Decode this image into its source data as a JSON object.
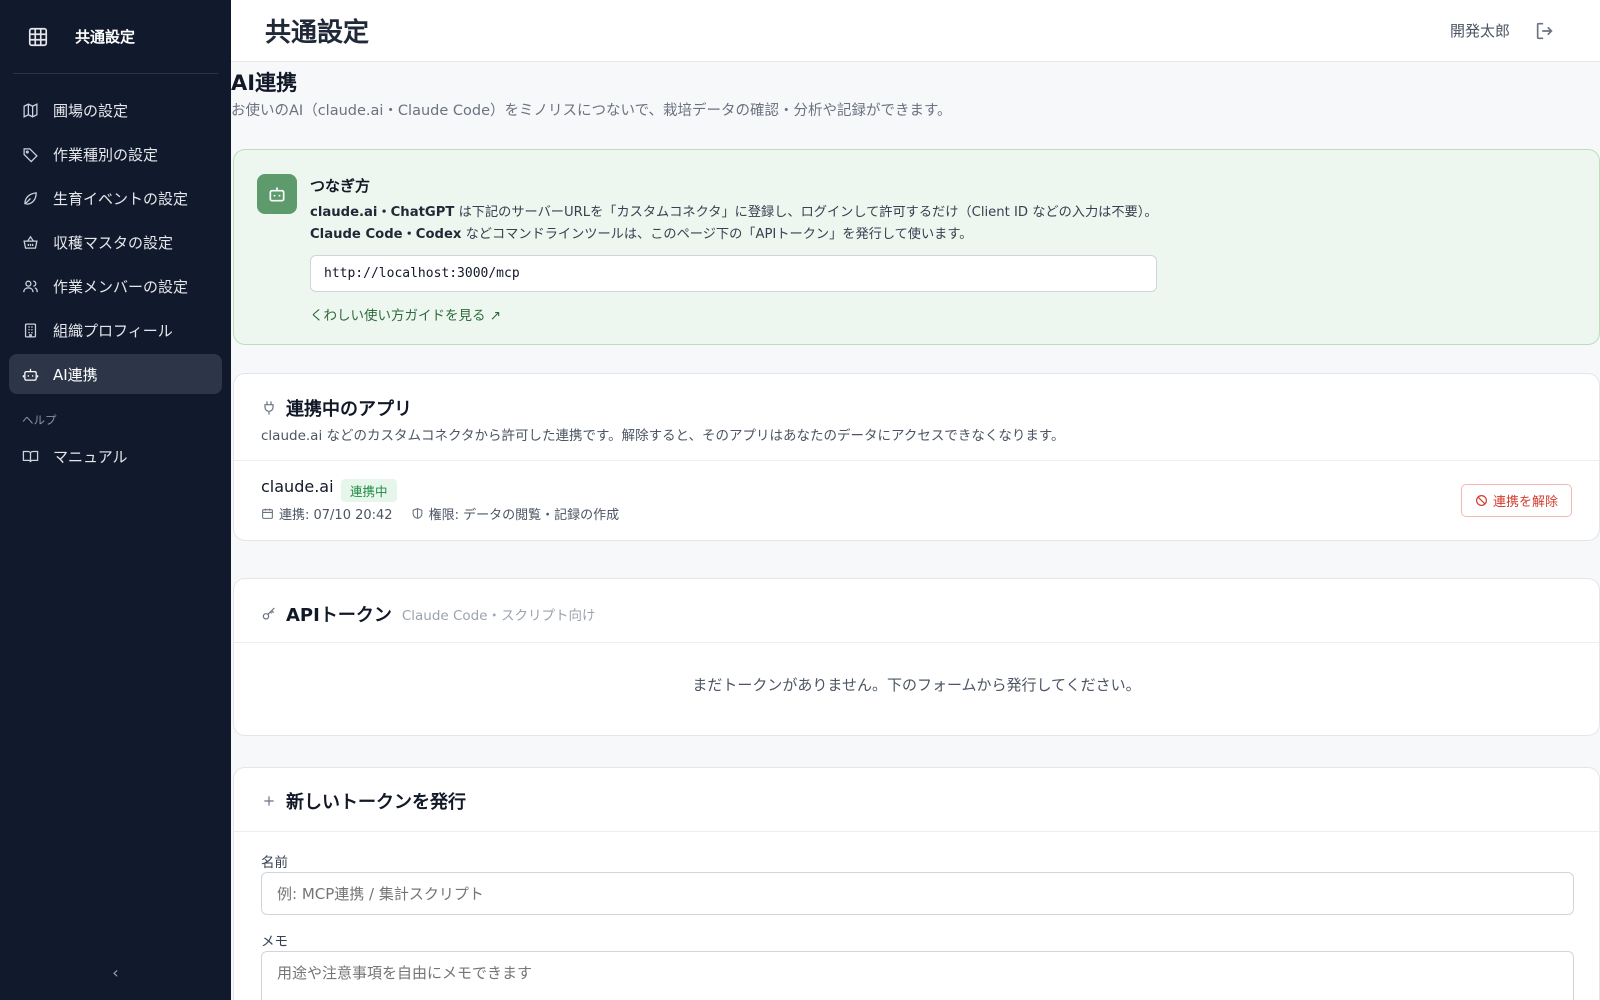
{
  "sidebar": {
    "title": "共通設定",
    "items": [
      {
        "label": "圃場の設定",
        "icon": "map-icon"
      },
      {
        "label": "作業種別の設定",
        "icon": "tag-icon"
      },
      {
        "label": "生育イベントの設定",
        "icon": "leaf-icon"
      },
      {
        "label": "収穫マスタの設定",
        "icon": "basket-icon"
      },
      {
        "label": "作業メンバーの設定",
        "icon": "users-icon"
      },
      {
        "label": "組織プロフィール",
        "icon": "building-icon"
      },
      {
        "label": "AI連携",
        "icon": "bot-icon",
        "active": true
      }
    ],
    "help_section": "ヘルプ",
    "help_items": [
      {
        "label": "マニュアル",
        "icon": "book-icon"
      }
    ],
    "collapse_icon": "‹"
  },
  "header": {
    "title": "共通設定",
    "user": "開発太郎"
  },
  "main": {
    "title": "AI連携",
    "description": "お使いのAI（claude.ai・Claude Code）をミノリスにつないで、栽培データの確認・分析や記録ができます。",
    "connect": {
      "title": "つなぎ方",
      "line1_bold": "claude.ai・ChatGPT",
      "line1_rest": " は下記のサーバーURLを「カスタムコネクタ」に登録し、ログインして許可するだけ（Client ID などの入力は不要）。",
      "line2_bold": "Claude Code・Codex",
      "line2_rest": " などコマンドラインツールは、このページ下の「APIトークン」を発行して使います。",
      "url": "http://localhost:3000/mcp",
      "guide_link": "くわしい使い方ガイドを見る ↗"
    },
    "apps": {
      "title": "連携中のアプリ",
      "description": "claude.ai などのカスタムコネクタから許可した連携です。解除すると、そのアプリはあなたのデータにアクセスできなくなります。",
      "rows": [
        {
          "name": "claude.ai",
          "status": "連携中",
          "connected": "連携: 07/10 20:42",
          "scope": "権限: データの閲覧・記録の作成",
          "revoke_label": "連携を解除"
        }
      ]
    },
    "tokens": {
      "title": "APIトークン",
      "subtitle": "Claude Code・スクリプト向け",
      "empty": "まだトークンがありません。下のフォームから発行してください。"
    },
    "new_token": {
      "title": "新しいトークンを発行",
      "name_label": "名前",
      "name_placeholder": "例: MCP連携 / 集計スクリプト",
      "memo_label": "メモ",
      "memo_placeholder": "用途や注意事項を自由にメモできます"
    }
  }
}
